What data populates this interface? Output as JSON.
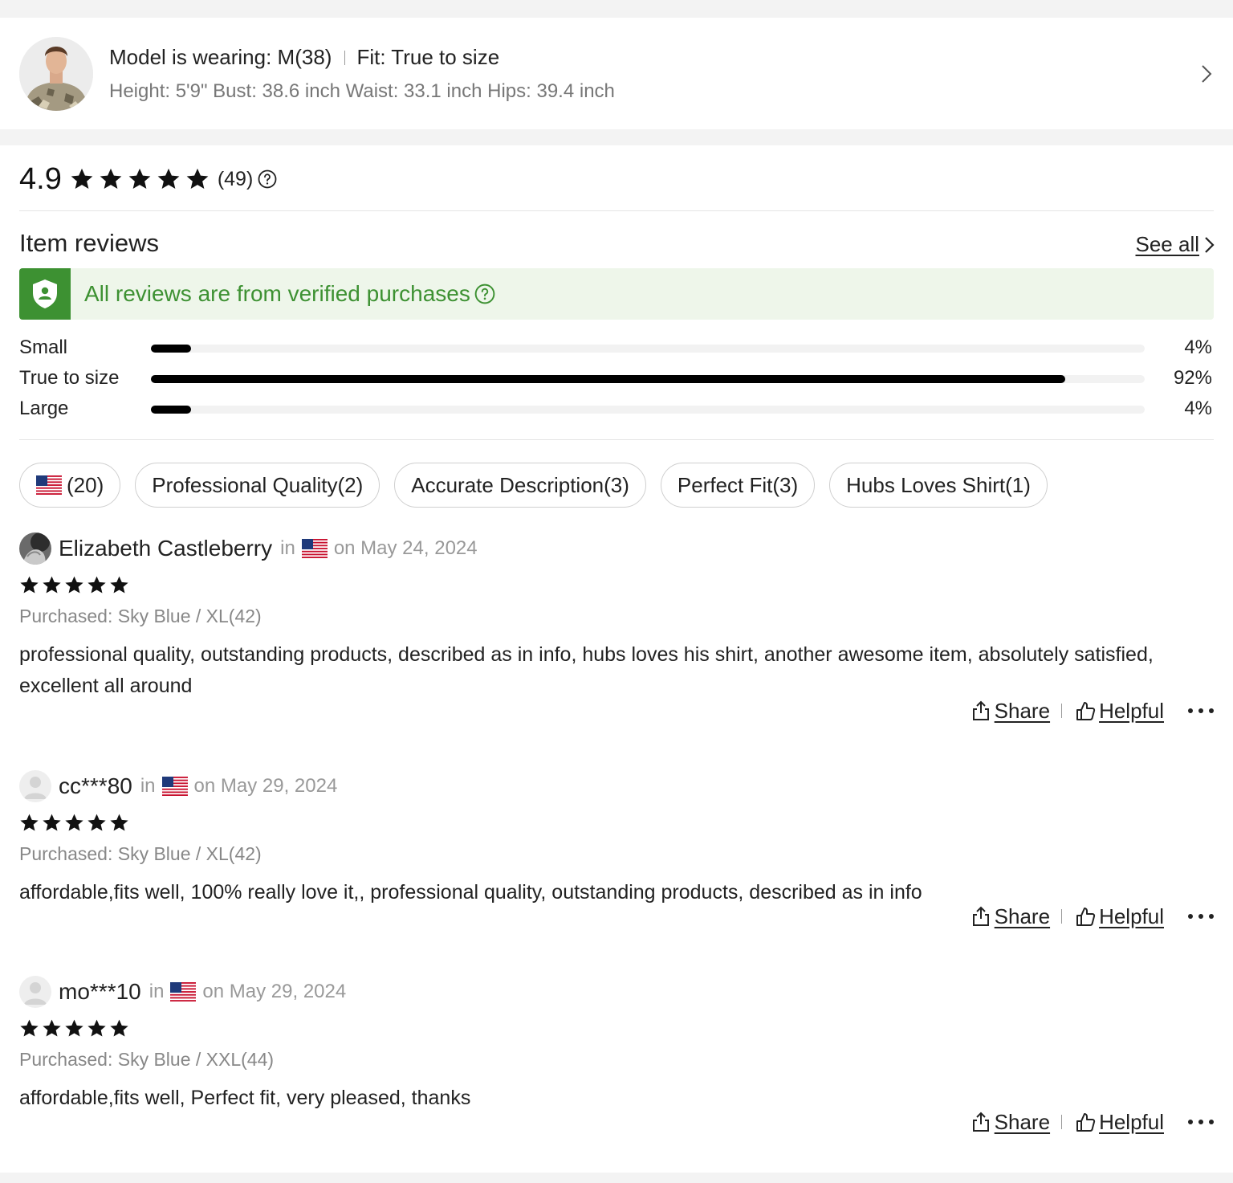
{
  "model": {
    "wearing": "Model is wearing: M(38)",
    "fit": "Fit: True to size",
    "measurements": "Height: 5'9\" Bust: 38.6 inch Waist: 33.1 inch Hips: 39.4 inch"
  },
  "rating": {
    "score": "4.9",
    "stars": 5,
    "count": "(49)"
  },
  "reviews_section": {
    "title": "Item reviews",
    "see_all": "See all",
    "verified_banner": "All reviews are from verified purchases"
  },
  "fit_distribution": [
    {
      "label": "Small",
      "percent_text": "4%",
      "value": 4
    },
    {
      "label": "True to size",
      "percent_text": "92%",
      "value": 92
    },
    {
      "label": "Large",
      "percent_text": "4%",
      "value": 4
    }
  ],
  "tags": [
    {
      "label": "(20)",
      "icon": "us-flag-icon"
    },
    {
      "label": "Professional Quality(2)"
    },
    {
      "label": "Accurate Description(3)"
    },
    {
      "label": "Perfect Fit(3)"
    },
    {
      "label": "Hubs Loves Shirt(1)"
    }
  ],
  "review_labels": {
    "in": "in",
    "share": "Share",
    "helpful": "Helpful"
  },
  "reviews": [
    {
      "name": "Elizabeth Castleberry",
      "date": "on May 24, 2024",
      "stars": 5,
      "purchased": "Purchased: Sky Blue / XL(42)",
      "text": "professional quality, outstanding products, described as in info, hubs loves his shirt, another awesome item, absolutely satisfied, excellent all around"
    },
    {
      "name": "cc***80",
      "date": "on May 29, 2024",
      "stars": 5,
      "purchased": "Purchased: Sky Blue / XL(42)",
      "text": "affordable,fits well, 100% really love it,, professional quality, outstanding products, described as in info"
    },
    {
      "name": "mo***10",
      "date": "on May 29, 2024",
      "stars": 5,
      "purchased": "Purchased: Sky Blue / XXL(44)",
      "text": "affordable,fits well, Perfect fit, very pleased, thanks"
    }
  ],
  "colors": {
    "verified_green": "#3d9132",
    "verified_bg": "#eef6ea",
    "bar_fill": "#000000",
    "bar_track": "#f2f2f2",
    "muted_text": "#999999"
  }
}
